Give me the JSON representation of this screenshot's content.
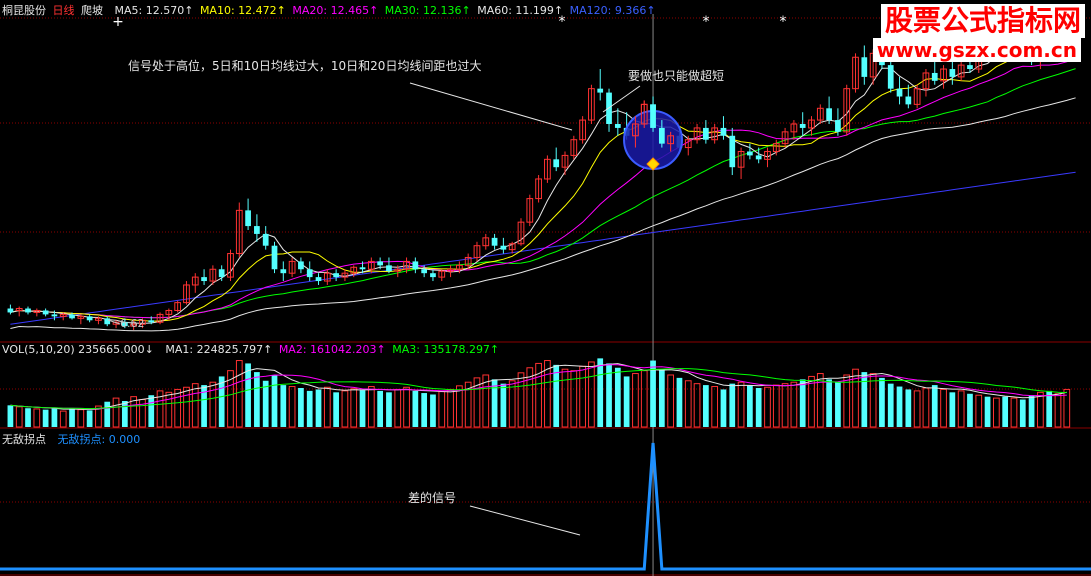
{
  "header_main": {
    "stock": "桐昆股份",
    "period": "日线",
    "formula": "爬坡",
    "items": [
      {
        "text": "MA5: 12.570↑",
        "color": "#e6e6e6"
      },
      {
        "text": "MA10: 12.472↑",
        "color": "#ffff00"
      },
      {
        "text": "MA20: 12.465↑",
        "color": "#ff00ff"
      },
      {
        "text": "MA30: 12.136↑",
        "color": "#00ff00"
      },
      {
        "text": "MA60: 11.199↑",
        "color": "#e6e6e6"
      },
      {
        "text": "MA120: 9.366↑",
        "color": "#3a60ff"
      }
    ]
  },
  "header_vol": {
    "label": "VOL(5,10,20) 235665.000↓",
    "items": [
      {
        "text": "MA1: 224825.797↑",
        "color": "#e6e6e6"
      },
      {
        "text": "MA2: 161042.203↑",
        "color": "#ff00ff"
      },
      {
        "text": "MA3: 135178.297↑",
        "color": "#00ff00"
      }
    ]
  },
  "header_ind": {
    "name": "无敌拐点",
    "value_text": "无敌拐点: 0.000"
  },
  "watermark": {
    "line1": "股票公式指标网",
    "line2": "www.gszx.com.cn"
  },
  "annotations": {
    "high_signal": "信号处于高位，5日和10日均线过大，10日和20日均线间距也过大",
    "short_only": "要做也只能做超短",
    "bad_signal": "差的信号",
    "low_price": "6.62"
  },
  "colors": {
    "up": "#ff3232",
    "down": "#54ffff",
    "grid": "#8b0000",
    "ma5": "#e6e6e6",
    "ma10": "#ffff00",
    "ma20": "#ff00ff",
    "ma30": "#00ff00",
    "ma60": "#e6e6e6",
    "ma120": "#3a3aff",
    "indicator": "#1e90ff"
  },
  "chart_data": {
    "type": "candlestick",
    "price_range": [
      6.2,
      14.3
    ],
    "signal_bar_index": 73,
    "ohlc": [
      [
        6.9,
        7.0,
        6.75,
        6.8
      ],
      [
        6.85,
        6.95,
        6.7,
        6.9
      ],
      [
        6.9,
        6.95,
        6.75,
        6.8
      ],
      [
        6.8,
        6.9,
        6.7,
        6.85
      ],
      [
        6.85,
        6.9,
        6.7,
        6.75
      ],
      [
        6.75,
        6.85,
        6.6,
        6.7
      ],
      [
        6.7,
        6.8,
        6.6,
        6.75
      ],
      [
        6.75,
        6.8,
        6.62,
        6.65
      ],
      [
        6.65,
        6.75,
        6.5,
        6.7
      ],
      [
        6.7,
        6.75,
        6.55,
        6.6
      ],
      [
        6.6,
        6.7,
        6.5,
        6.65
      ],
      [
        6.65,
        6.7,
        6.45,
        6.5
      ],
      [
        6.5,
        6.6,
        6.4,
        6.55
      ],
      [
        6.55,
        6.65,
        6.4,
        6.45
      ],
      [
        6.45,
        6.6,
        6.35,
        6.5
      ],
      [
        6.5,
        6.65,
        6.4,
        6.6
      ],
      [
        6.6,
        6.7,
        6.5,
        6.55
      ],
      [
        6.55,
        6.8,
        6.5,
        6.75
      ],
      [
        6.75,
        6.9,
        6.6,
        6.85
      ],
      [
        6.85,
        7.1,
        6.8,
        7.05
      ],
      [
        7.05,
        7.6,
        7.0,
        7.5
      ],
      [
        7.5,
        7.8,
        7.3,
        7.7
      ],
      [
        7.7,
        7.9,
        7.5,
        7.6
      ],
      [
        7.6,
        8.0,
        7.5,
        7.9
      ],
      [
        7.9,
        8.0,
        7.6,
        7.7
      ],
      [
        7.7,
        8.4,
        7.6,
        8.3
      ],
      [
        8.3,
        9.6,
        8.2,
        9.4
      ],
      [
        9.4,
        9.7,
        8.9,
        9.0
      ],
      [
        9.0,
        9.3,
        8.6,
        8.8
      ],
      [
        8.8,
        9.0,
        8.4,
        8.5
      ],
      [
        8.5,
        8.6,
        7.8,
        7.9
      ],
      [
        7.9,
        8.1,
        7.6,
        7.8
      ],
      [
        7.8,
        8.2,
        7.7,
        8.1
      ],
      [
        8.1,
        8.2,
        7.8,
        7.9
      ],
      [
        7.9,
        8.1,
        7.6,
        7.7
      ],
      [
        7.7,
        7.8,
        7.5,
        7.6
      ],
      [
        7.6,
        7.9,
        7.5,
        7.8
      ],
      [
        7.8,
        7.9,
        7.6,
        7.7
      ],
      [
        7.7,
        7.9,
        7.6,
        7.8
      ],
      [
        7.8,
        8.0,
        7.7,
        7.95
      ],
      [
        7.95,
        8.1,
        7.8,
        7.9
      ],
      [
        7.9,
        8.2,
        7.8,
        8.1
      ],
      [
        8.1,
        8.2,
        7.9,
        8.0
      ],
      [
        8.0,
        8.2,
        7.8,
        7.85
      ],
      [
        7.85,
        8.0,
        7.7,
        7.9
      ],
      [
        7.9,
        8.2,
        7.8,
        8.1
      ],
      [
        8.1,
        8.2,
        7.8,
        7.9
      ],
      [
        7.9,
        8.0,
        7.7,
        7.8
      ],
      [
        7.8,
        7.9,
        7.6,
        7.7
      ],
      [
        7.7,
        7.9,
        7.6,
        7.85
      ],
      [
        7.85,
        8.0,
        7.7,
        7.9
      ],
      [
        7.9,
        8.1,
        7.8,
        8.0
      ],
      [
        8.0,
        8.3,
        7.9,
        8.2
      ],
      [
        8.2,
        8.6,
        8.1,
        8.5
      ],
      [
        8.5,
        8.8,
        8.4,
        8.7
      ],
      [
        8.7,
        8.8,
        8.4,
        8.5
      ],
      [
        8.5,
        8.7,
        8.3,
        8.4
      ],
      [
        8.4,
        8.6,
        8.3,
        8.55
      ],
      [
        8.55,
        9.2,
        8.5,
        9.1
      ],
      [
        9.1,
        9.8,
        9.0,
        9.7
      ],
      [
        9.7,
        10.3,
        9.6,
        10.2
      ],
      [
        10.2,
        10.8,
        10.1,
        10.7
      ],
      [
        10.7,
        11.0,
        10.4,
        10.5
      ],
      [
        10.5,
        10.9,
        10.3,
        10.8
      ],
      [
        10.8,
        11.3,
        10.7,
        11.2
      ],
      [
        11.2,
        11.8,
        11.1,
        11.7
      ],
      [
        11.7,
        12.6,
        11.6,
        12.5
      ],
      [
        12.5,
        13.0,
        12.2,
        12.4
      ],
      [
        12.4,
        12.5,
        11.4,
        11.6
      ],
      [
        11.6,
        12.0,
        11.3,
        11.5
      ],
      [
        11.5,
        11.9,
        11.2,
        11.3
      ],
      [
        11.3,
        11.8,
        11.0,
        11.6
      ],
      [
        11.6,
        12.2,
        11.5,
        12.1
      ],
      [
        12.1,
        12.3,
        11.4,
        11.5
      ],
      [
        11.5,
        11.7,
        11.0,
        11.1
      ],
      [
        11.1,
        11.4,
        10.9,
        11.3
      ],
      [
        11.3,
        11.5,
        10.9,
        11.0
      ],
      [
        11.0,
        11.3,
        10.8,
        11.2
      ],
      [
        11.2,
        11.6,
        11.1,
        11.5
      ],
      [
        11.5,
        11.7,
        11.1,
        11.2
      ],
      [
        11.2,
        11.6,
        11.1,
        11.5
      ],
      [
        11.5,
        11.8,
        11.2,
        11.3
      ],
      [
        11.3,
        11.5,
        10.3,
        10.5
      ],
      [
        10.5,
        11.0,
        10.2,
        10.9
      ],
      [
        10.9,
        11.1,
        10.7,
        10.8
      ],
      [
        10.8,
        11.0,
        10.6,
        10.7
      ],
      [
        10.7,
        11.0,
        10.5,
        10.9
      ],
      [
        10.9,
        11.2,
        10.8,
        11.1
      ],
      [
        11.1,
        11.5,
        11.0,
        11.4
      ],
      [
        11.4,
        11.7,
        11.2,
        11.6
      ],
      [
        11.6,
        11.9,
        11.3,
        11.5
      ],
      [
        11.5,
        11.8,
        11.3,
        11.7
      ],
      [
        11.7,
        12.1,
        11.6,
        12.0
      ],
      [
        12.0,
        12.3,
        11.6,
        11.7
      ],
      [
        11.7,
        12.0,
        11.3,
        11.4
      ],
      [
        11.4,
        12.6,
        11.3,
        12.5
      ],
      [
        12.5,
        13.4,
        12.4,
        13.3
      ],
      [
        13.3,
        13.6,
        12.6,
        12.8
      ],
      [
        12.8,
        13.5,
        12.6,
        13.4
      ],
      [
        13.4,
        13.9,
        13.0,
        13.1
      ],
      [
        13.1,
        13.3,
        12.4,
        12.5
      ],
      [
        12.5,
        12.8,
        12.1,
        12.3
      ],
      [
        12.3,
        12.6,
        12.0,
        12.1
      ],
      [
        12.1,
        12.6,
        12.0,
        12.5
      ],
      [
        12.5,
        13.0,
        12.3,
        12.9
      ],
      [
        12.9,
        13.2,
        12.6,
        12.7
      ],
      [
        12.7,
        13.1,
        12.5,
        13.0
      ],
      [
        13.0,
        13.2,
        12.6,
        12.8
      ],
      [
        12.8,
        13.2,
        12.7,
        13.1
      ],
      [
        13.1,
        13.4,
        12.9,
        13.0
      ],
      [
        13.0,
        13.6,
        12.9,
        13.5
      ],
      [
        13.5,
        13.8,
        13.2,
        13.3
      ],
      [
        13.3,
        13.9,
        13.2,
        13.8
      ],
      [
        13.8,
        14.2,
        13.5,
        13.6
      ],
      [
        13.6,
        14.1,
        13.4,
        14.0
      ],
      [
        14.0,
        14.3,
        13.6,
        13.7
      ],
      [
        13.7,
        13.9,
        13.1,
        13.2
      ],
      [
        13.2,
        13.6,
        13.0,
        13.5
      ],
      [
        13.5,
        13.8,
        13.2,
        13.4
      ],
      [
        13.4,
        13.7,
        13.2,
        13.6
      ],
      [
        13.6,
        13.9,
        13.4,
        13.7
      ],
      [
        13.7,
        14.0,
        13.5,
        13.9
      ]
    ],
    "volume": [
      30,
      28,
      26,
      25,
      24,
      27,
      22,
      26,
      24,
      23,
      29,
      35,
      40,
      36,
      42,
      38,
      44,
      50,
      48,
      52,
      55,
      60,
      58,
      62,
      70,
      78,
      92,
      88,
      76,
      64,
      72,
      58,
      56,
      54,
      50,
      52,
      55,
      48,
      50,
      53,
      51,
      56,
      50,
      48,
      52,
      55,
      50,
      47,
      45,
      49,
      52,
      57,
      62,
      68,
      72,
      66,
      60,
      64,
      75,
      82,
      88,
      92,
      86,
      80,
      78,
      84,
      90,
      95,
      88,
      82,
      70,
      74,
      78,
      92,
      80,
      72,
      68,
      64,
      60,
      58,
      56,
      52,
      60,
      62,
      58,
      54,
      55,
      58,
      60,
      62,
      66,
      70,
      74,
      66,
      62,
      72,
      80,
      76,
      74,
      68,
      60,
      56,
      52,
      50,
      54,
      58,
      52,
      48,
      50,
      46,
      44,
      42,
      40,
      42,
      40,
      38,
      44,
      48,
      50,
      46,
      52
    ],
    "indicator": {
      "zero_value": 0,
      "spike_index": 73,
      "spike_value": 1
    }
  }
}
